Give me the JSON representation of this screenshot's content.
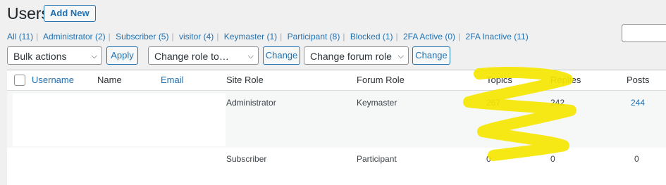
{
  "header": {
    "title": "Users",
    "add_new": "Add New"
  },
  "filters": [
    {
      "label": "All",
      "count": "(11)"
    },
    {
      "label": "Administrator",
      "count": "(2)"
    },
    {
      "label": "Subscriber",
      "count": "(5)"
    },
    {
      "label": "visitor",
      "count": "(4)"
    },
    {
      "label": "Keymaster",
      "count": "(1)"
    },
    {
      "label": "Participant",
      "count": "(8)"
    },
    {
      "label": "Blocked",
      "count": "(1)"
    },
    {
      "label": "2FA Active",
      "count": "(0)"
    },
    {
      "label": "2FA Inactive",
      "count": "(11)"
    }
  ],
  "toolbar": {
    "bulk_actions": "Bulk actions",
    "apply": "Apply",
    "change_role": "Change role to…",
    "change_1": "Change",
    "change_forum_role": "Change forum role to…",
    "change_2": "Change"
  },
  "table": {
    "headers": {
      "username": "Username",
      "name": "Name",
      "email": "Email",
      "site_role": "Site Role",
      "forum_role": "Forum Role",
      "topics": "Topics",
      "replies": "Replies",
      "posts": "Posts"
    },
    "rows": [
      {
        "site_role": "Administrator",
        "forum_role": "Keymaster",
        "topics": "267",
        "replies": "242",
        "posts": "244"
      },
      {
        "site_role": "Subscriber",
        "forum_role": "Participant",
        "topics": "0",
        "replies": "0",
        "posts": "0"
      }
    ]
  },
  "colors": {
    "link": "#2271b1",
    "highlight": "#f5e600"
  }
}
